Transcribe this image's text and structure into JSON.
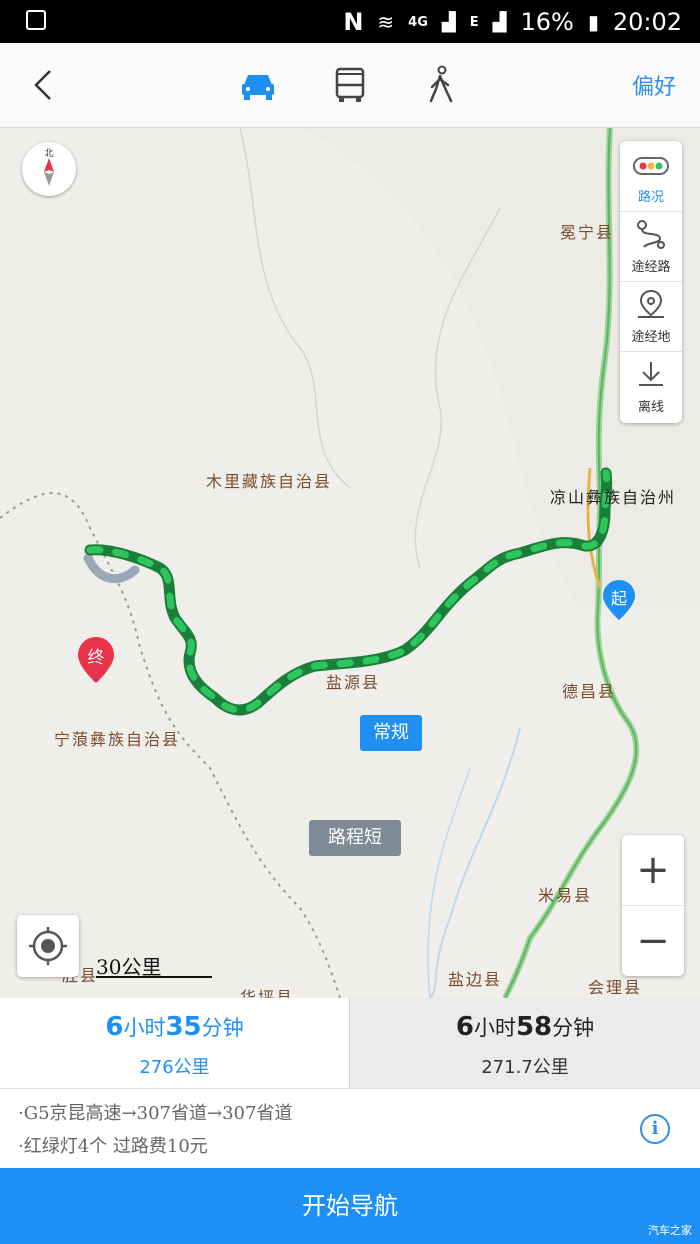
{
  "status_bar": {
    "network": "4G",
    "sim": "E",
    "battery": "16%",
    "time": "20:02"
  },
  "header": {
    "preference_label": "偏好"
  },
  "map": {
    "tools": [
      {
        "label": "路况"
      },
      {
        "label": "途经路"
      },
      {
        "label": "途经地"
      },
      {
        "label": "离线"
      }
    ],
    "places": {
      "muli": "木里藏族自治县",
      "mianning": "冕宁县",
      "liangshan": "凉山彝族自治州",
      "ninglang": "宁蒗彝族自治县",
      "yanyuan": "盐源县",
      "dechang": "德昌县",
      "miyi": "米易县",
      "yanbian": "盐边县",
      "huili": "会理县",
      "huaping": "华坪县",
      "shengxian": "胜县"
    },
    "route_tags": {
      "regular": "常规",
      "shorter": "路程短"
    },
    "markers": {
      "start": "起",
      "end": "终"
    },
    "scale": "30公里"
  },
  "routes": [
    {
      "time_h": "6",
      "time_h_unit": "小时",
      "time_m": "35",
      "time_m_unit": "分钟",
      "distance": "276公里",
      "selected": true
    },
    {
      "time_h": "6",
      "time_h_unit": "小时",
      "time_m": "58",
      "time_m_unit": "分钟",
      "distance": "271.7公里",
      "selected": false
    }
  ],
  "details": {
    "road": "·G5京昆高速→307省道→307省道",
    "extra": "·红绿灯4个   过路费10元"
  },
  "start_button": "开始导航",
  "watermark": "汽车之家",
  "colors": {
    "accent": "#1e90f5",
    "route": "#1aa84a",
    "end_marker": "#e8334a"
  }
}
